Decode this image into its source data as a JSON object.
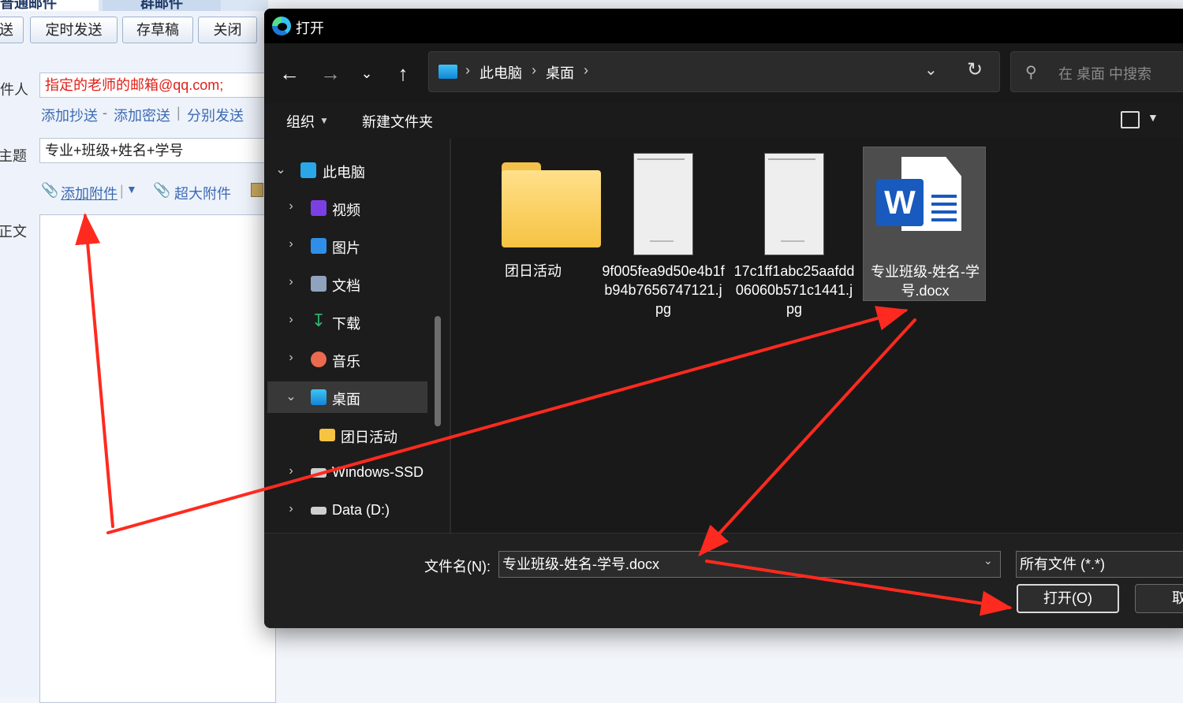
{
  "mail": {
    "tabs": [
      "普通邮件",
      "群邮件"
    ],
    "buttons": {
      "send": "发送",
      "scheduled": "定时发送",
      "draft": "存草稿",
      "close": "关闭"
    },
    "labels": {
      "recipient": "收件人",
      "subject": "主题",
      "body": "正文"
    },
    "recipient_value": "指定的老师的邮箱@qq.com;",
    "links": {
      "cc": "添加抄送",
      "bcc": "添加密送",
      "separate": "分别发送",
      "dash": "-",
      "pipe": "|"
    },
    "subject_value": "专业+班级+姓名+学号",
    "attach": {
      "add": "添加附件",
      "large": "超大附件"
    }
  },
  "dialog": {
    "title": "打开",
    "breadcrumb": [
      "此电脑",
      "桌面"
    ],
    "search_placeholder": "在 桌面 中搜索",
    "commands": {
      "organize": "组织",
      "new_folder": "新建文件夹"
    },
    "tree": [
      {
        "label": "此电脑",
        "icon": "pc-icon",
        "color": "#2aa7e8"
      },
      {
        "label": "视频",
        "icon": "video-icon",
        "color": "#7b3fe4"
      },
      {
        "label": "图片",
        "icon": "picture-icon",
        "color": "#2f8fe8"
      },
      {
        "label": "文档",
        "icon": "document-icon",
        "color": "#8fa3bf"
      },
      {
        "label": "下载",
        "icon": "download-icon",
        "color": "#2fb36a"
      },
      {
        "label": "音乐",
        "icon": "music-icon",
        "color": "#e96a4f"
      },
      {
        "label": "桌面",
        "icon": "desktop-icon",
        "color": "#2aa7e8"
      },
      {
        "label": "团日活动",
        "icon": "folder-icon",
        "color": "#f6c343"
      },
      {
        "label": "Windows-SSD",
        "icon": "drive-windows-icon",
        "color": "#2aa7e8"
      },
      {
        "label": "Data (D:)",
        "icon": "drive-icon",
        "color": "#cfcfcf"
      }
    ],
    "files": [
      {
        "name": "团日活动",
        "type": "folder"
      },
      {
        "name": "9f005fea9d50e4b1fb94b7656747121.jpg",
        "type": "image"
      },
      {
        "name": "17c1ff1abc25aafdd06060b571c1441.jpg",
        "type": "image"
      },
      {
        "name": "专业班级-姓名-学号.docx",
        "type": "word"
      }
    ],
    "footer": {
      "filename_label": "文件名(N):",
      "filename_value": "专业班级-姓名-学号.docx",
      "filetype": "所有文件 (*.*)",
      "open": "打开(O)",
      "cancel": "取消"
    }
  },
  "colors": {
    "arrow": "#ff2a1f",
    "link": "#3d6ab3",
    "recipient_text": "#e0201a",
    "selection": "#4d4d4d"
  }
}
